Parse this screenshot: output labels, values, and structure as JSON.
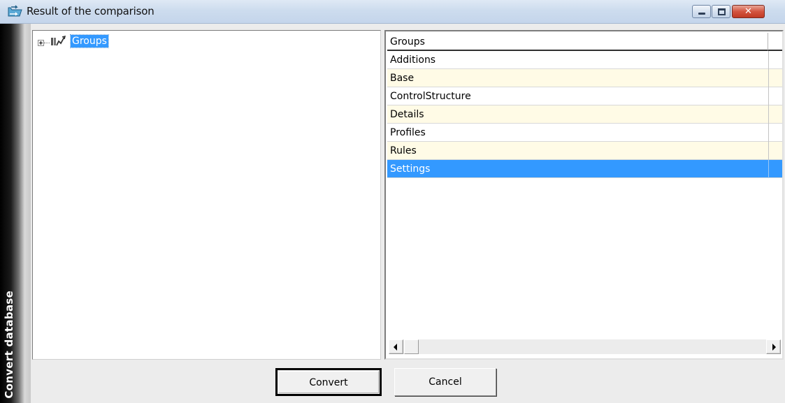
{
  "window": {
    "title": "Result of the comparison",
    "icon": "folder-transfer-icon",
    "controls": {
      "minimize": "minimize-icon",
      "maximize": "maximize-icon",
      "close": "close-icon",
      "close_glyph": "✕"
    }
  },
  "sidebar": {
    "label": "Convert database"
  },
  "tree": {
    "items": [
      {
        "label": "Groups",
        "icon": "tables-icon",
        "expanded": false,
        "selected": true
      }
    ]
  },
  "list": {
    "header": "Groups",
    "rows": [
      {
        "label": "Additions",
        "style": "normal"
      },
      {
        "label": "Base",
        "style": "alt"
      },
      {
        "label": "ControlStructure",
        "style": "normal"
      },
      {
        "label": "Details",
        "style": "alt"
      },
      {
        "label": "Profiles",
        "style": "normal"
      },
      {
        "label": "Rules",
        "style": "alt"
      },
      {
        "label": "Settings",
        "style": "selected"
      }
    ]
  },
  "buttons": {
    "convert": "Convert",
    "cancel": "Cancel"
  },
  "colors": {
    "selection": "#3399ff",
    "alt_row": "#fffbe6",
    "title_bar": "#cddcee"
  }
}
